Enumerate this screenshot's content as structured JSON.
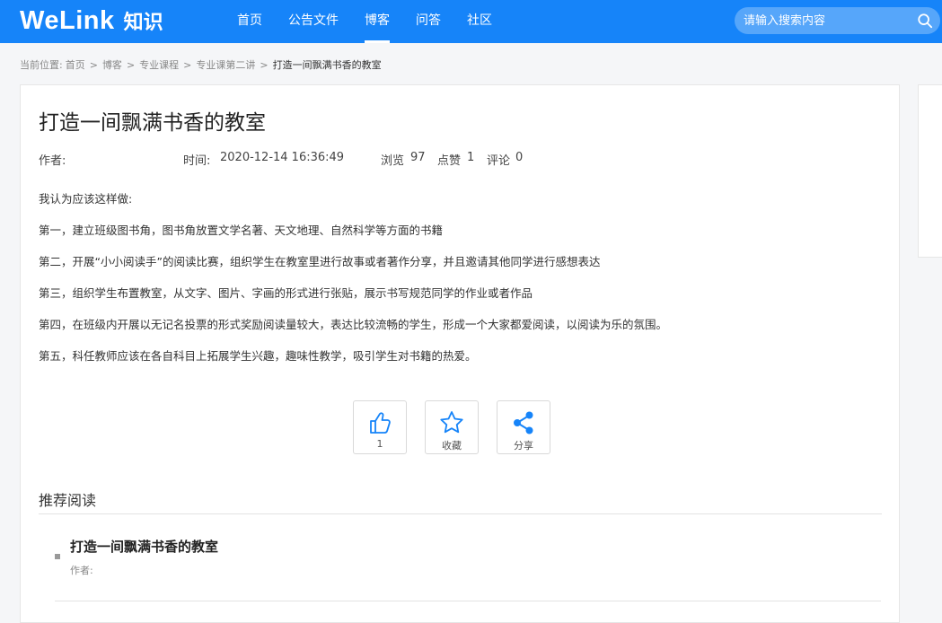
{
  "header": {
    "logo_main": "WeLink",
    "logo_sub": "知识",
    "nav": [
      {
        "label": "首页"
      },
      {
        "label": "公告文件"
      },
      {
        "label": "博客"
      },
      {
        "label": "问答"
      },
      {
        "label": "社区"
      }
    ],
    "active_nav": "博客",
    "search_placeholder": "请输入搜索内容",
    "brand_color": "#1684f9"
  },
  "breadcrumb": {
    "prefix": "当前位置:",
    "items": [
      "首页",
      "博客",
      "专业课程",
      "专业课第二讲"
    ],
    "current": "打造一间飘满书香的教室"
  },
  "article": {
    "title": "打造一间飘满书香的教室",
    "author_label": "作者:",
    "author": "",
    "time_label": "时间:",
    "time": "2020-12-14 16:36:49",
    "views_label": "浏览",
    "views": "97",
    "likes_label": "点赞",
    "likes": "1",
    "comments_label": "评论",
    "comments": "0",
    "paragraphs": [
      "我认为应该这样做:",
      "第一，建立班级图书角，图书角放置文学名著、天文地理、自然科学等方面的书籍",
      "第二，开展“小小阅读手”的阅读比赛，组织学生在教室里进行故事或者著作分享，并且邀请其他同学进行感想表达",
      "第三，组织学生布置教室，从文字、图片、字画的形式进行张贴，展示书写规范同学的作业或者作品",
      "第四，在班级内开展以无记名投票的形式奖励阅读量较大，表达比较流畅的学生，形成一个大家都爱阅读，以阅读为乐的氛围。",
      "第五，科任教师应该在各自科目上拓展学生兴趣，趣味性教学，吸引学生对书籍的热爱。"
    ]
  },
  "actions": {
    "like_count": "1",
    "favorite_label": "收藏",
    "share_label": "分享",
    "icon_color": "#1684f9"
  },
  "recommend": {
    "heading": "推荐阅读",
    "items": [
      {
        "title": "打造一间飘满书香的教室",
        "author_label": "作者:"
      }
    ]
  }
}
